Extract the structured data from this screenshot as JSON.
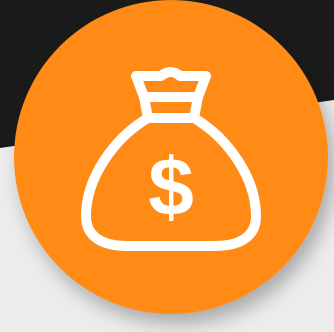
{
  "icon": {
    "name": "money-bag-icon",
    "symbol": "$"
  },
  "colors": {
    "circle": "#ff8a16",
    "stroke": "#ffffff",
    "background_dark": "#1b1b1b",
    "background_light": "#ececec"
  }
}
